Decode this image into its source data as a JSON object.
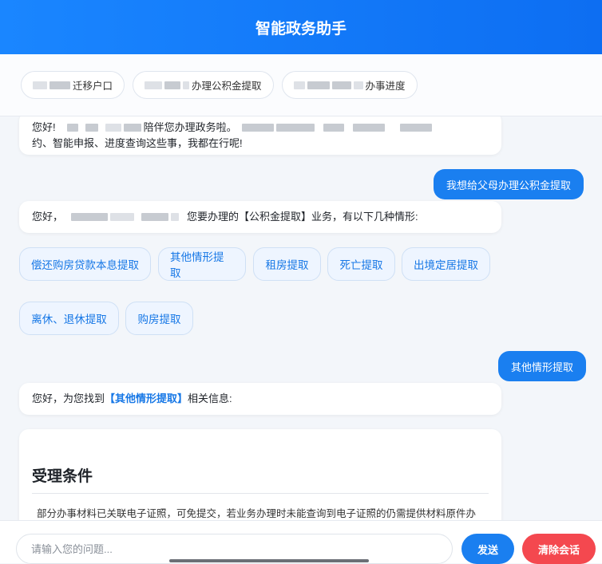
{
  "header": {
    "title": "智能政务助手"
  },
  "quick_actions": [
    {
      "label": "迁移户口"
    },
    {
      "label": "办理公积金提取"
    },
    {
      "label": "办事进度"
    }
  ],
  "messages": {
    "greeting": {
      "line1_a": "您好!",
      "line1_b": "陪伴您办理政务啦。",
      "line2": "约、智能申报、进度查询这些事，我都在行呢!"
    },
    "user_1": "我想给父母办理公积金提取",
    "reply_1": {
      "prefix": "您好，",
      "suffix": "您要办理的【公积金提取】业务，有以下几种情形:"
    },
    "options": [
      "偿还购房贷款本息提取",
      "其他情形提取",
      "租房提取",
      "死亡提取",
      "出境定居提取",
      "离休、退休提取",
      "购房提取"
    ],
    "user_2": "其他情形提取",
    "reply_2": {
      "prefix": "您好，为您找到",
      "highlight": "【其他情形提取】",
      "suffix": "相关信息:"
    },
    "info_card": {
      "title": "受理条件",
      "text": "部分办事材料已关联电子证照，可免提交，若业务办理时未能查询到电子证照的仍需提供材料原件办"
    }
  },
  "input": {
    "placeholder": "请输入您的问题..."
  },
  "buttons": {
    "send": "发送",
    "clear": "清除会话"
  }
}
